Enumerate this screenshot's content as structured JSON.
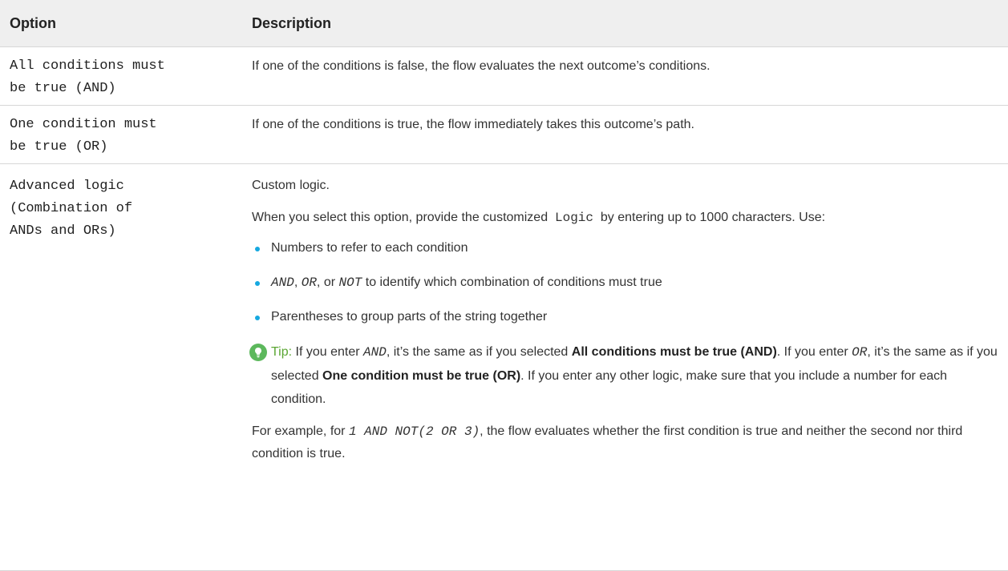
{
  "table": {
    "headers": {
      "option": "Option",
      "description": "Description"
    },
    "rows": [
      {
        "option_line1": "All conditions must",
        "option_line2": "be true (AND)",
        "description": "If one of the conditions is false, the flow evaluates the next outcome’s conditions."
      },
      {
        "option_line1": "One condition must",
        "option_line2": "be true (OR)",
        "description": "If one of the conditions is true, the flow immediately takes this outcome’s path."
      },
      {
        "option_line1": "Advanced logic",
        "option_line2": "(Combination of",
        "option_line3": "ANDs and ORs)",
        "intro": "Custom logic.",
        "select_text_before": "When you select this option, provide the customized",
        "select_code": "Logic",
        "select_text_after": "by entering up to 1000 characters. Use:",
        "bullets": {
          "b1": "Numbers to refer to each condition",
          "b2_code_and": "AND",
          "b2_sep1": ",",
          "b2_code_or": "OR",
          "b2_sep2": ", or",
          "b2_code_not": "NOT",
          "b2_text": "to identify which combination of conditions must true",
          "b3": "Parentheses to group parts of the string together"
        },
        "tip": {
          "label": "Tip:",
          "t1": "If you enter",
          "code_and": "AND",
          "t2": ", it’s the same as if you selected",
          "bold_and": "All conditions must be true (AND)",
          "t3": ". If you enter",
          "code_or": "OR",
          "t4": ", it’s the same as if you selected",
          "bold_or": "One condition must be true (OR)",
          "t5": ". If you enter any other logic, make sure that you include a number for each condition."
        },
        "example": {
          "before": "For example, for",
          "code": "1 AND NOT(2 OR 3)",
          "after": ", the flow evaluates whether the first condition is true and neither the second nor third condition is true."
        }
      }
    ]
  },
  "colors": {
    "header_bg": "#efefef",
    "divider": "#d7d7d7",
    "bullet": "#16a8e0",
    "tip_icon": "#5cb85c",
    "tip_label": "#5aa633"
  },
  "icons": {
    "tip": "lightbulb-icon",
    "bullet": "bullet-dot"
  }
}
